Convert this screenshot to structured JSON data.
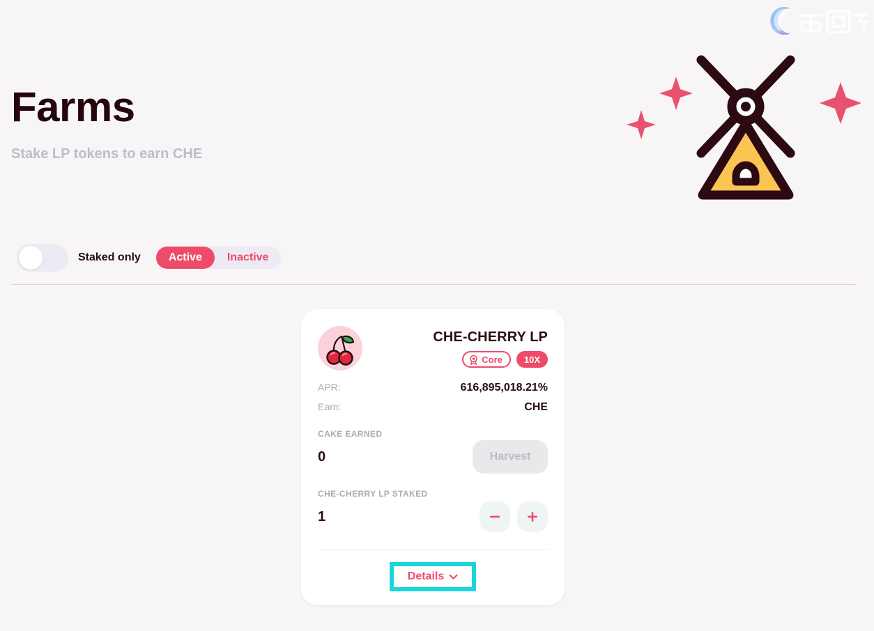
{
  "watermark": {
    "icon": "logo-c-swoosh",
    "text": "币圈子"
  },
  "hero": {
    "icon": "windmill-illustration",
    "sparkle_icon": "sparkle-icon"
  },
  "header": {
    "title": "Farms",
    "subtitle": "Stake LP tokens to earn CHE"
  },
  "controls": {
    "staked_only_label": "Staked only",
    "staked_only_on": false,
    "tabs": [
      {
        "label": "Active",
        "selected": true
      },
      {
        "label": "Inactive",
        "selected": false
      }
    ]
  },
  "farm": {
    "token_icon": "cherry-icon",
    "pair_name": "CHE-CHERRY LP",
    "badges": {
      "core_label": "Core",
      "core_icon": "medal-icon",
      "multiplier_label": "10X"
    },
    "stats": [
      {
        "key": "APR:",
        "value": "616,895,018.21%"
      },
      {
        "key": "Earn:",
        "value": "CHE"
      }
    ],
    "earned": {
      "label": "CAKE EARNED",
      "amount": "0",
      "harvest_label": "Harvest"
    },
    "staked": {
      "label": "CHE-CHERRY LP STAKED",
      "amount": "1",
      "minus_icon": "minus-icon",
      "plus_icon": "plus-icon"
    },
    "details_label": "Details",
    "details_chevron_icon": "chevron-down-icon"
  },
  "colors": {
    "accent": "#ED4B6A",
    "highlight": "#18D6DB",
    "page_bg": "#F7F5F6",
    "text_dark": "#280D12",
    "text_muted": "#ADA9B5",
    "windmill_body": "#FBC453"
  }
}
